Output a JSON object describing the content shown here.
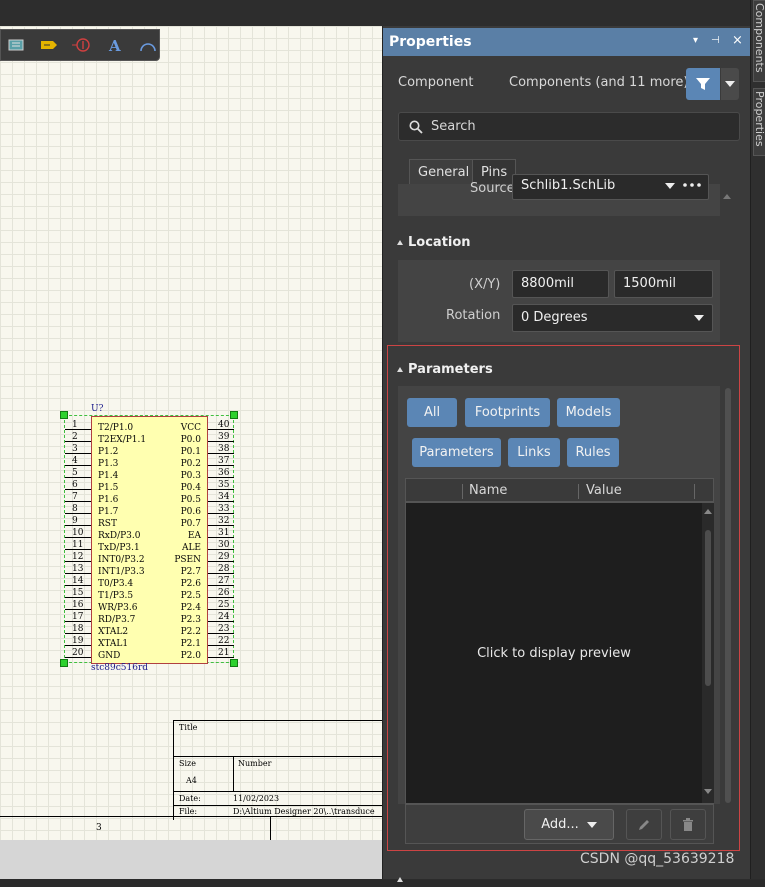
{
  "canvas": {
    "component": {
      "designator": "U?",
      "comment": "stc89c516rd",
      "left_pins": [
        {
          "num": "1",
          "name": "T2/P1.0"
        },
        {
          "num": "2",
          "name": "T2EX/P1.1"
        },
        {
          "num": "3",
          "name": "P1.2"
        },
        {
          "num": "4",
          "name": "P1.3"
        },
        {
          "num": "5",
          "name": "P1.4"
        },
        {
          "num": "6",
          "name": "P1.5"
        },
        {
          "num": "7",
          "name": "P1.6"
        },
        {
          "num": "8",
          "name": "P1.7"
        },
        {
          "num": "9",
          "name": "RST"
        },
        {
          "num": "10",
          "name": "RxD/P3.0"
        },
        {
          "num": "11",
          "name": "TxD/P3.1"
        },
        {
          "num": "12",
          "name": "INT0/P3.2"
        },
        {
          "num": "13",
          "name": "INT1/P3.3"
        },
        {
          "num": "14",
          "name": "T0/P3.4"
        },
        {
          "num": "15",
          "name": "T1/P3.5"
        },
        {
          "num": "16",
          "name": "WR/P3.6"
        },
        {
          "num": "17",
          "name": "RD/P3.7"
        },
        {
          "num": "18",
          "name": "XTAL2"
        },
        {
          "num": "19",
          "name": "XTAL1"
        },
        {
          "num": "20",
          "name": "GND"
        }
      ],
      "right_pins": [
        {
          "num": "40",
          "name": "VCC"
        },
        {
          "num": "39",
          "name": "P0.0"
        },
        {
          "num": "38",
          "name": "P0.1"
        },
        {
          "num": "37",
          "name": "P0.2"
        },
        {
          "num": "36",
          "name": "P0.3"
        },
        {
          "num": "35",
          "name": "P0.4"
        },
        {
          "num": "34",
          "name": "P0.5"
        },
        {
          "num": "33",
          "name": "P0.6"
        },
        {
          "num": "32",
          "name": "P0.7"
        },
        {
          "num": "31",
          "name": "EA"
        },
        {
          "num": "30",
          "name": "ALE"
        },
        {
          "num": "29",
          "name": "PSEN"
        },
        {
          "num": "28",
          "name": "P2.7"
        },
        {
          "num": "27",
          "name": "P2.6"
        },
        {
          "num": "26",
          "name": "P2.5"
        },
        {
          "num": "25",
          "name": "P2.4"
        },
        {
          "num": "24",
          "name": "P2.3"
        },
        {
          "num": "23",
          "name": "P2.2"
        },
        {
          "num": "22",
          "name": "P2.1"
        },
        {
          "num": "21",
          "name": "P2.0"
        }
      ]
    },
    "title_block": {
      "title_label": "Title",
      "size_label": "Size",
      "size_value": "A4",
      "number_label": "Number",
      "date_label": "Date:",
      "date_value": "11/02/2023",
      "file_label": "File:",
      "file_value": "D:\\Altium Designer 20\\..\\transduce"
    },
    "zone_label": "3"
  },
  "panel": {
    "title": "Properties",
    "controls": {
      "dropdown": "▾",
      "pin": "⊣",
      "close": "×"
    },
    "filter_label": "Component",
    "filter_value": "Components (and 11 more)",
    "search_placeholder": "Search",
    "tabs": [
      "General",
      "Pins"
    ],
    "source_label": "Source",
    "source_value": "Schlib1.SchLib",
    "location": {
      "title": "Location",
      "xy_label": "(X/Y)",
      "x_value": "8800mil",
      "y_value": "1500mil",
      "rotation_label": "Rotation",
      "rotation_value": "0 Degrees"
    },
    "parameters": {
      "title": "Parameters",
      "filters": [
        "All",
        "Footprints",
        "Models",
        "Parameters",
        "Links",
        "Rules"
      ],
      "columns": [
        "Name",
        "Value"
      ],
      "preview_text": "Click to display preview",
      "add_label": "Add..."
    }
  },
  "dock_tabs": [
    "Components",
    "Properties"
  ],
  "watermark": "CSDN @qq_53639218",
  "colors": {
    "accent": "#5b86b5",
    "header": "#5a7fa6",
    "highlight": "#cc4444"
  }
}
